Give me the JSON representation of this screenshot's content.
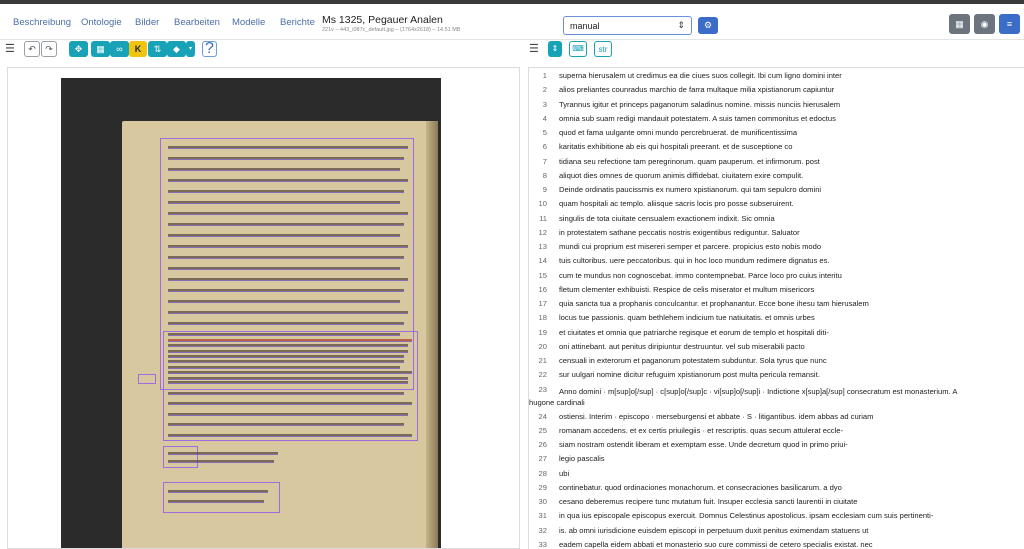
{
  "nav": {
    "items": [
      "Beschreibung",
      "Ontologie",
      "Bilder",
      "Bearbeiten",
      "Modelle",
      "Berichte"
    ]
  },
  "doc": {
    "title": "Ms 1325, Pegauer Analen",
    "meta": "221v – 443_i087c_default.jpg – (1764x2618) – 14.51 MB"
  },
  "mode_select": {
    "value": "manual"
  },
  "toolbar": {
    "yellow_label": "K",
    "help_label": "?",
    "str_label": "str"
  },
  "transcription": [
    {
      "n": "1",
      "t": "superna hierusalem ut credimus ea die ciues suos collegit. Ibi cum ligno domini inter"
    },
    {
      "n": "2",
      "t": "alios preliantes counradus marchio de farra multaque milia xpistianorum capiuntur"
    },
    {
      "n": "3",
      "t": "Tyrannus igitur et princeps paganorum saladinus nomine. missis nunciis hierusalem"
    },
    {
      "n": "4",
      "t": "omnia sub suam redigi mandauit potestatem. A suis tamen commonitus et edoctus"
    },
    {
      "n": "5",
      "t": "quod et fama uulgante omni mundo percrebruerat. de munificentissima"
    },
    {
      "n": "6",
      "t": "karitatis exhibitione ab eis qui hospitali preerant. et de susceptione co"
    },
    {
      "n": "7",
      "t": "tidiana seu refectione tam peregrinorum. quam pauperum. et infirmorum. post"
    },
    {
      "n": "8",
      "t": "aliquot dies omnes de quorum animis diffidebat. ciuitatem exire compulit."
    },
    {
      "n": "9",
      "t": "Deinde ordinatis paucissmis ex numero xpistianorum. qui tam sepulcro domini"
    },
    {
      "n": "10",
      "t": "quam hospitali ac templo. aliisque sacris locis pro posse subseruirent."
    },
    {
      "n": "11",
      "t": "singulis de tota ciuitate censualem exactionem indixit. Sic omnia"
    },
    {
      "n": "12",
      "t": "in protestatem sathane peccatis nostris exigentibus rediguntur. Saluator"
    },
    {
      "n": "13",
      "t": "mundi cui proprium est misereri semper et parcere. propicius esto nobis modo"
    },
    {
      "n": "14",
      "t": "tuis cultoribus. uere peccatoribus. qui in hoc loco mundum redimere dignatus es."
    },
    {
      "n": "15",
      "t": "cum te mundus non cognoscebat. immo contempnebat. Parce loco pro cuius interitu"
    },
    {
      "n": "16",
      "t": "fletum clementer exhibuisti. Respice de celis miserator et multum misericors"
    },
    {
      "n": "17",
      "t": "quia sancta tua a prophanis conculcantur. et prophanantur. Ecce bone ihesu tam hierusalem"
    },
    {
      "n": "18",
      "t": "locus tue passionis. quam bethlehem indicium tue natiuitatis. et omnis urbes"
    },
    {
      "n": "19",
      "t": "et ciuitates et omnia que patriarche regisque et eorum de templo et hospitali diti-"
    },
    {
      "n": "20",
      "t": "oni attinebant. aut penitus diripiuntur destruuntur. vel sub miserabili pacto"
    },
    {
      "n": "21",
      "t": "censuali in exterorum et paganorum potestatem subduntur. Sola tyrus que nunc"
    },
    {
      "n": "22",
      "t": "sur uulgari nomine dicitur refuguim xpistianorum post multa pericula remansit."
    },
    {
      "n": "23",
      "t": "Anno domini · m[sup]o[/sup] · c[sup]o[/sup]c · vi[sup]o[/sup]i · Indictione x[sup]a[/sup] consecratum est monasterium. A",
      "wrap": "hugone cardinali"
    },
    {
      "n": "24",
      "t": "ostiensi. Interim · episcopo · merseburgensi et abbate · S · litigantibus. idem abbas ad curiam"
    },
    {
      "n": "25",
      "t": "romanam accedens. et ex certis priuilegiis · et rescriptis. quas secum attulerat eccle-"
    },
    {
      "n": "26",
      "t": "siam nostram ostendit liberam et exemptam esse. Unde decretum quod in primo priui-"
    },
    {
      "n": "27",
      "t": "legio pascalis"
    },
    {
      "n": "28",
      "t": "ubi"
    },
    {
      "n": "29",
      "t": "continebatur. quod ordinaciones monachorum. et consecraciones basilicarum. a dyo"
    },
    {
      "n": "30",
      "t": "cesano deberemus recipere tunc mutatum fuit. Insuper ecclesia sancti laurentii in ciuitate"
    },
    {
      "n": "31",
      "t": "in qua ius episcopale episcopus exercuit. Domnus Celestinus apostolicus. ipsam ecclesiam cum suis pertinenti-"
    },
    {
      "n": "32",
      "t": "is. ab omni iurisdicione euisdem episcopi in perpetuum duxit penitus eximendam statuens ut"
    },
    {
      "n": "33",
      "t": "eadem capella eidem abbati et monasterio suo cure commissi de cetero specialis existat. nec"
    }
  ],
  "colors": {
    "accent": "#3b6cc7",
    "teal": "#17a2b8",
    "region": "#a36be0"
  }
}
